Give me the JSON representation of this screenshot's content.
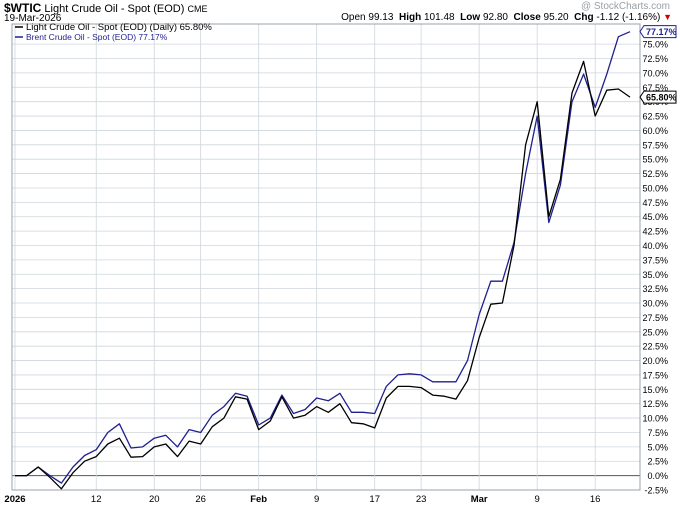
{
  "header": {
    "symbol": "$WTIC",
    "name": "Light Crude Oil - Spot (EOD)",
    "exchange": "CME",
    "date": "19-Mar-2026",
    "watermark": "@ StockCharts.com",
    "quote": {
      "open_label": "Open",
      "open": "99.13",
      "high_label": "High",
      "high": "101.48",
      "low_label": "Low",
      "low": "92.80",
      "close_label": "Close",
      "close": "95.20",
      "chg_label": "Chg",
      "chg": "-1.12 (-1.16%)",
      "chg_arrow": "▼"
    }
  },
  "colors": {
    "wti": "#000000",
    "brent": "#1f1f8f",
    "grid": "#cfd6dc",
    "frame": "#9aa3ab",
    "zero_line": "#555555",
    "background": "#ffffff"
  },
  "chart_data": {
    "type": "line",
    "ylim": [
      -2.5,
      78.5
    ],
    "y_ticks": [
      -2.5,
      0,
      2.5,
      5,
      7.5,
      10,
      12.5,
      15,
      17.5,
      20,
      22.5,
      25,
      27.5,
      30,
      32.5,
      35,
      37.5,
      40,
      42.5,
      45,
      47.5,
      50,
      52.5,
      55,
      57.5,
      60,
      62.5,
      65,
      67.5,
      70,
      72.5,
      75
    ],
    "y_tick_labels": [
      "-2.5%",
      "0.0%",
      "2.5%",
      "5.0%",
      "7.5%",
      "10.0%",
      "12.5%",
      "15.0%",
      "17.5%",
      "20.0%",
      "22.5%",
      "25.0%",
      "27.5%",
      "30.0%",
      "32.5%",
      "35.0%",
      "37.5%",
      "40.0%",
      "42.5%",
      "45.0%",
      "47.5%",
      "50.0%",
      "52.5%",
      "55.0%",
      "57.5%",
      "60.0%",
      "62.5%",
      "65.0%",
      "67.5%",
      "70.0%",
      "72.5%",
      "75.0%"
    ],
    "x_tick_labels": [
      {
        "label": "2026",
        "index": 0,
        "bold": true
      },
      {
        "label": "12",
        "index": 7,
        "bold": false
      },
      {
        "label": "20",
        "index": 12,
        "bold": false
      },
      {
        "label": "26",
        "index": 16,
        "bold": false
      },
      {
        "label": "Feb",
        "index": 21,
        "bold": true
      },
      {
        "label": "9",
        "index": 26,
        "bold": false
      },
      {
        "label": "17",
        "index": 31,
        "bold": false
      },
      {
        "label": "23",
        "index": 35,
        "bold": false
      },
      {
        "label": "Mar",
        "index": 40,
        "bold": true
      },
      {
        "label": "9",
        "index": 45,
        "bold": false
      },
      {
        "label": "16",
        "index": 50,
        "bold": false
      }
    ],
    "grid": true,
    "legend_position": "top-left",
    "series": [
      {
        "name": "Light Crude Oil - Spot (EOD) (Daily) 65.80%",
        "color_key": "wti",
        "end_label": "65.80%",
        "values": [
          0.0,
          0.0,
          1.5,
          -0.3,
          -2.3,
          0.5,
          2.5,
          3.3,
          5.5,
          6.5,
          3.2,
          3.3,
          5.0,
          5.5,
          3.3,
          6.0,
          5.5,
          8.5,
          10.0,
          13.7,
          13.3,
          8.0,
          9.5,
          13.7,
          10.0,
          10.5,
          12.0,
          11.0,
          12.5,
          9.2,
          9.0,
          8.3,
          13.5,
          15.5,
          15.5,
          15.3,
          14.0,
          13.8,
          13.3,
          16.5,
          24.0,
          29.8,
          30.0,
          40.0,
          57.5,
          65.0,
          45.0,
          51.5,
          66.5,
          72.0,
          62.5,
          67.0,
          67.2,
          65.8
        ],
        "dates": [
          "Jan 1",
          "Jan 2",
          "Jan 5",
          "Jan 6",
          "Jan 7",
          "Jan 8",
          "Jan 9",
          "Jan 12",
          "Jan 13",
          "Jan 14",
          "Jan 15",
          "Jan 16",
          "Jan 19",
          "Jan 20",
          "Jan 21",
          "Jan 22",
          "Jan 23",
          "Jan 26",
          "Jan 27",
          "Jan 28",
          "Jan 29",
          "Jan 30",
          "Feb 2",
          "Feb 3",
          "Feb 4",
          "Feb 5",
          "Feb 6",
          "Feb 9",
          "Feb 10",
          "Feb 11",
          "Feb 12",
          "Feb 13",
          "Feb 16",
          "Feb 17",
          "Feb 18",
          "Feb 19",
          "Feb 20",
          "Feb 23",
          "Feb 24",
          "Feb 25",
          "Feb 26",
          "Feb 27",
          "Mar 2",
          "Mar 3",
          "Mar 4",
          "Mar 5",
          "Mar 6",
          "Mar 9",
          "Mar 10",
          "Mar 11",
          "Mar 12",
          "Mar 13",
          "Mar 16",
          "Mar 17"
        ]
      },
      {
        "name": "Brent Crude Oil - Spot (EOD) 77.17%",
        "color_key": "brent",
        "end_label": "77.17%",
        "values": [
          0.0,
          0.0,
          1.5,
          0.0,
          -1.3,
          1.5,
          3.5,
          4.5,
          7.5,
          9.0,
          4.8,
          5.0,
          6.5,
          7.0,
          5.0,
          8.0,
          7.5,
          10.5,
          12.0,
          14.3,
          13.8,
          8.8,
          10.0,
          14.0,
          10.8,
          11.5,
          13.5,
          13.0,
          14.3,
          11.0,
          11.0,
          10.8,
          15.5,
          17.5,
          17.7,
          17.5,
          16.3,
          16.3,
          16.3,
          20.0,
          28.0,
          33.8,
          33.8,
          40.5,
          52.5,
          62.5,
          44.0,
          50.5,
          65.0,
          69.8,
          64.0,
          69.8,
          76.3,
          77.17
        ],
        "dates": [
          "Jan 1",
          "Jan 2",
          "Jan 5",
          "Jan 6",
          "Jan 7",
          "Jan 8",
          "Jan 9",
          "Jan 12",
          "Jan 13",
          "Jan 14",
          "Jan 15",
          "Jan 16",
          "Jan 19",
          "Jan 20",
          "Jan 21",
          "Jan 22",
          "Jan 23",
          "Jan 26",
          "Jan 27",
          "Jan 28",
          "Jan 29",
          "Jan 30",
          "Feb 2",
          "Feb 3",
          "Feb 4",
          "Feb 5",
          "Feb 6",
          "Feb 9",
          "Feb 10",
          "Feb 11",
          "Feb 12",
          "Feb 13",
          "Feb 16",
          "Feb 17",
          "Feb 18",
          "Feb 19",
          "Feb 20",
          "Feb 23",
          "Feb 24",
          "Feb 25",
          "Feb 26",
          "Feb 27",
          "Mar 2",
          "Mar 3",
          "Mar 4",
          "Mar 5",
          "Mar 6",
          "Mar 9",
          "Mar 10",
          "Mar 11",
          "Mar 12",
          "Mar 13",
          "Mar 16",
          "Mar 17"
        ]
      }
    ]
  }
}
